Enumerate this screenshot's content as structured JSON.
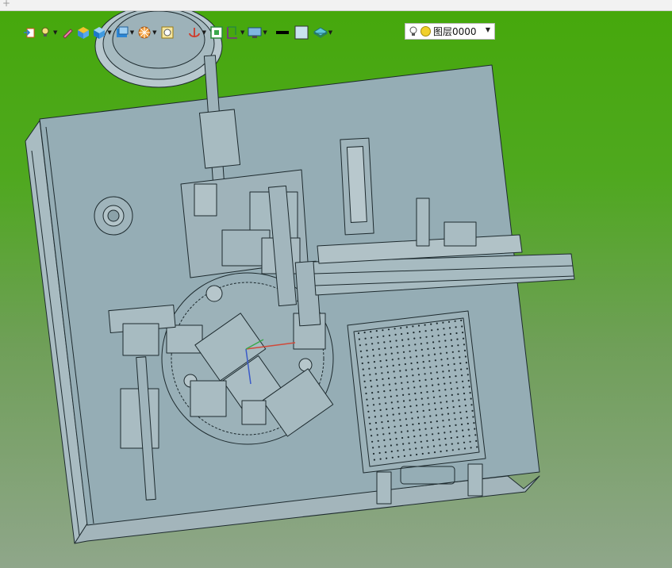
{
  "titlebar": {
    "symbol": "+"
  },
  "toolbar": {
    "items": [
      {
        "icon": "import-icon"
      },
      {
        "icon": "light-bulb-icon"
      },
      {
        "icon": "pen-icon"
      },
      {
        "icon": "view-cube-icon"
      },
      {
        "icon": "shaded-cube-icon"
      },
      {
        "icon": "display-mode-icon"
      },
      {
        "icon": "section-view-icon"
      },
      {
        "icon": "zoom-box-icon"
      },
      {
        "icon": "rotate-axis-icon"
      },
      {
        "icon": "fit-screen-icon"
      },
      {
        "icon": "view-orientation-icon"
      },
      {
        "icon": "monitor-icon"
      },
      {
        "icon": "line-color-icon"
      },
      {
        "icon": "fill-color-icon"
      },
      {
        "icon": "layer-stack-icon"
      }
    ],
    "layer_select": {
      "value": "图层0000"
    }
  },
  "colors": {
    "background_top": "#46a80c",
    "background_bottom": "#8fa68a",
    "model_fill": "#95adb5",
    "model_line": "#1d2a2e"
  }
}
